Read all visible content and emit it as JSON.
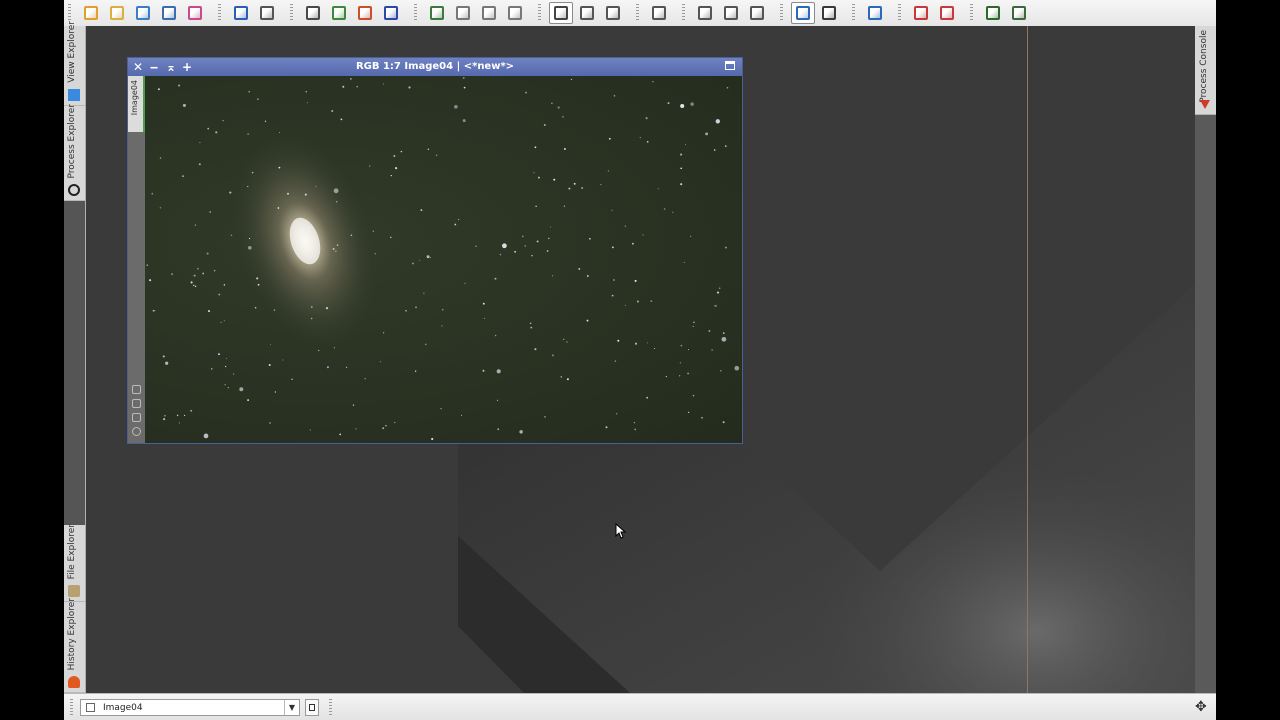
{
  "toolbar": {
    "groups": [
      {
        "buttons": [
          {
            "icon": "open-file-icon",
            "color": "#e0a030"
          },
          {
            "icon": "open-folder-icon",
            "color": "#d9b040"
          },
          {
            "icon": "save-icon",
            "color": "#3a7ec8"
          },
          {
            "icon": "save-as-icon",
            "color": "#3a6cb0"
          },
          {
            "icon": "color-image-icon",
            "color": "#c84a8a"
          }
        ]
      },
      {
        "buttons": [
          {
            "icon": "undo-icon",
            "color": "#2a5fb8"
          },
          {
            "icon": "redo-icon",
            "color": "#555555"
          }
        ]
      },
      {
        "buttons": [
          {
            "icon": "new-image-icon",
            "color": "#4a4a4a"
          },
          {
            "icon": "duplicate-image-icon",
            "color": "#3a8a3a"
          },
          {
            "icon": "channel-extract-icon",
            "color": "#c8502a"
          },
          {
            "icon": "rgb-working-space-icon",
            "color": "#2a4aa8"
          }
        ]
      },
      {
        "buttons": [
          {
            "icon": "zoom-fit-icon",
            "color": "#3a7a3a"
          },
          {
            "icon": "zoom-in-icon",
            "color": "#777777"
          },
          {
            "icon": "zoom-out-icon",
            "color": "#777777"
          },
          {
            "icon": "zoom-1-1-icon",
            "color": "#777777"
          }
        ]
      },
      {
        "buttons": [
          {
            "icon": "readout-mode-icon",
            "color": "#444444",
            "active": true
          },
          {
            "icon": "pan-mode-icon",
            "color": "#555555"
          },
          {
            "icon": "zoom-mode-icon",
            "color": "#555555"
          }
        ]
      },
      {
        "buttons": [
          {
            "icon": "preview-mode-icon",
            "color": "#555555"
          }
        ]
      },
      {
        "buttons": [
          {
            "icon": "edit-preview-icon",
            "color": "#555555"
          },
          {
            "icon": "new-preview-icon",
            "color": "#555555"
          },
          {
            "icon": "delete-preview-icon",
            "color": "#555555"
          }
        ]
      },
      {
        "buttons": [
          {
            "icon": "screen-transfer-function-icon",
            "color": "#2a6ab8",
            "active": true
          },
          {
            "icon": "auto-stretch-icon",
            "color": "#3a3a3a"
          }
        ]
      },
      {
        "buttons": [
          {
            "icon": "display-channel-icon",
            "color": "#2a6ab8"
          }
        ]
      },
      {
        "buttons": [
          {
            "icon": "mask-show-icon",
            "color": "#c83a3a"
          },
          {
            "icon": "mask-invert-icon",
            "color": "#c83a3a"
          }
        ]
      },
      {
        "buttons": [
          {
            "icon": "track-view-icon",
            "color": "#2a6a2a"
          },
          {
            "icon": "display-settings-icon",
            "color": "#3a6a3a"
          }
        ]
      }
    ]
  },
  "left_panel": {
    "tabs": [
      {
        "label": "View Explorer",
        "icon": "view-explorer-icon",
        "color": "#3a8ae0"
      },
      {
        "label": "Process Explorer",
        "icon": "gear-icon",
        "color": "#222222"
      },
      {
        "label": "File Explorer",
        "icon": "file-explorer-icon",
        "color": "#b8a070"
      },
      {
        "label": "History Explorer",
        "icon": "history-icon",
        "color": "#e05a20"
      }
    ]
  },
  "right_panel": {
    "tabs": [
      {
        "label": "Process Console",
        "icon": "process-console-icon",
        "color": "#d03a2a"
      }
    ]
  },
  "image_window": {
    "title": "RGB 1:7 Image04 | <*new*>",
    "tab_label": "Image04",
    "controls": [
      "close-icon",
      "minimize-icon",
      "shade-icon",
      "pin-icon"
    ],
    "accent_color": "#5a6ea8"
  },
  "bottom_bar": {
    "view_selector_value": "Image04"
  }
}
